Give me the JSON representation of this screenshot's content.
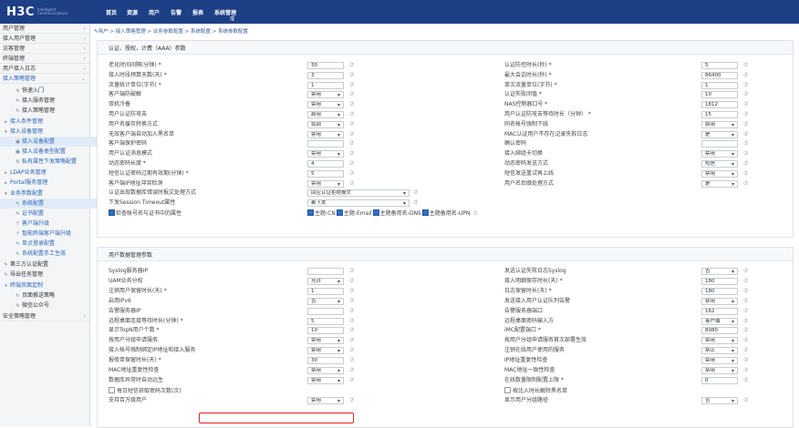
{
  "header": {
    "logo": "H3C",
    "logo_sub": "Intelligent Communications",
    "nav": [
      "首页",
      "资源",
      "用户",
      "告警",
      "报表",
      "系统管理"
    ],
    "nav_sub": "理"
  },
  "sidebar": {
    "items": [
      {
        "label": "用户管理"
      },
      {
        "label": "接入用户管理"
      },
      {
        "label": "访客管理"
      },
      {
        "label": "终端管理"
      },
      {
        "label": "用户接入日志"
      },
      {
        "label": "接入策略管理"
      },
      {
        "label": "快速入门"
      },
      {
        "label": "接入服务管理"
      },
      {
        "label": "接入策略管理"
      },
      {
        "label": "接入条件管理"
      },
      {
        "label": "接入设备管理"
      },
      {
        "label": "接入设备配置"
      },
      {
        "label": "接入设备类型配置"
      },
      {
        "label": "私有属性下发策略配置"
      },
      {
        "label": "LDAP业务管理"
      },
      {
        "label": "Portal服务管理"
      },
      {
        "label": "业务参数配置"
      },
      {
        "label": "系统配置"
      },
      {
        "label": "证书配置"
      },
      {
        "label": "客户端升级"
      },
      {
        "label": "智能终端客户端升级"
      },
      {
        "label": "单点登录配置"
      },
      {
        "label": "系统配置手工生效"
      },
      {
        "label": "第三方认证配置"
      },
      {
        "label": "导出任务管理"
      },
      {
        "label": "终端页面定制"
      },
      {
        "label": "页面推送策略"
      },
      {
        "label": "微信公众号"
      },
      {
        "label": "安全策略管理"
      }
    ]
  },
  "breadcrumb": "用户 > 接入策略管理 > 业务参数配置 > 系统配置 > 系统参数配置",
  "aaa": {
    "title": "认证、授权、计费（AAA）参数",
    "left": [
      {
        "label": "老化时间间隔(分钟) *",
        "value": "30",
        "type": "text"
      },
      {
        "label": "接入时段预算天数(天) *",
        "value": "3",
        "type": "text"
      },
      {
        "label": "流量统计单位(字节) *",
        "value": "1",
        "type": "text"
      },
      {
        "label": "客户端防破解",
        "value": "禁用",
        "type": "select"
      },
      {
        "label": "双机冷备",
        "value": "禁用",
        "type": "select"
      },
      {
        "label": "用户认证防攻击",
        "value": "启用",
        "type": "select"
      },
      {
        "label": "用户名缓存转换方式",
        "value": "如调",
        "type": "select"
      },
      {
        "label": "无效客户端自动加入黑名单",
        "value": "禁用",
        "type": "select"
      },
      {
        "label": "客户端保护密码",
        "value": "",
        "type": "text"
      },
      {
        "label": "用户认证消息模式",
        "value": "禁用",
        "type": "select"
      },
      {
        "label": "动态密码长度 *",
        "value": "4",
        "type": "text"
      },
      {
        "label": "短信认证密码过期有效期(分钟) *",
        "value": "5",
        "type": "text"
      },
      {
        "label": "客户端IP地址冲突检测",
        "value": "禁用",
        "type": "select"
      },
      {
        "label": "认证出现数据库错误时报文处理方式",
        "value": "回应认证拒绝报文",
        "type": "select"
      },
      {
        "label": "下发Session Timeout属性",
        "value": "都下发",
        "type": "select"
      },
      {
        "label": "检查帐号名与证书中的属性",
        "value": "",
        "type": "checks"
      }
    ],
    "right": [
      {
        "label": "认证防控时长(秒) *",
        "value": "5",
        "type": "text"
      },
      {
        "label": "最大会话时长(秒) *",
        "value": "86400",
        "type": "text"
      },
      {
        "label": "单次流量单位(字节) *",
        "value": "1",
        "type": "text"
      },
      {
        "label": "认证失败闭值 *",
        "value": "10",
        "type": "text"
      },
      {
        "label": "NAS控制器口号 *",
        "value": "1812",
        "type": "text"
      },
      {
        "label": "用户认证防攻击等待时长（分钟） *",
        "value": "15",
        "type": "text"
      },
      {
        "label": "同名帐号强制下线",
        "value": "启用",
        "type": "select"
      },
      {
        "label": "MAC认证用户不存在记录失败日志",
        "value": "是",
        "type": "select"
      },
      {
        "label": "确认密码",
        "value": "",
        "type": "text"
      },
      {
        "label": "接入绑组卡切换",
        "value": "禁用",
        "type": "select"
      },
      {
        "label": "动态密码发送方式",
        "value": "短信",
        "type": "select"
      },
      {
        "label": "短信发送重试再上线",
        "value": "禁用",
        "type": "select"
      },
      {
        "label": "用户名后缀处理方式",
        "value": "是",
        "type": "select"
      }
    ],
    "cert_checks": [
      "主题-CN",
      "主题-Email",
      "主题备用名-DNS",
      "主题备用名-UPN"
    ]
  },
  "user": {
    "title": "用户数据管理参数",
    "left": [
      {
        "label": "Syslog服务器IP",
        "value": "",
        "type": "text"
      },
      {
        "label": "UAM业务分权",
        "value": "允许",
        "type": "select"
      },
      {
        "label": "注销用户保留时长(天) *",
        "value": "1",
        "type": "text"
      },
      {
        "label": "启用IPv6",
        "value": "否",
        "type": "select"
      },
      {
        "label": "告警服务器IP",
        "value": "",
        "type": "text"
      },
      {
        "label": "远程桌面连接等待时长(分钟) *",
        "value": "5",
        "type": "text"
      },
      {
        "label": "显示TopN用户个数 *",
        "value": "10",
        "type": "text"
      },
      {
        "label": "按用户分组申请服务",
        "value": "禁用",
        "type": "select"
      },
      {
        "label": "接入帐号强制绑定IP地址和接入服务",
        "value": "禁用",
        "type": "select"
      },
      {
        "label": "报修单保留时长(天) *",
        "value": "30",
        "type": "text"
      },
      {
        "label": "MAC地址重复性检查",
        "value": "禁用",
        "type": "select"
      },
      {
        "label": "数据库异常时自动远生",
        "value": "禁用",
        "type": "select"
      },
      {
        "label": "每日短信获取密码次数(次)",
        "value": "",
        "type": "check"
      },
      {
        "label": "支持百万级用户",
        "value": "禁用",
        "type": "select"
      }
    ],
    "right": [
      {
        "label": "发送认证失败日志Syslog",
        "value": "否",
        "type": "select"
      },
      {
        "label": "接入明细保存时长(天) *",
        "value": "180",
        "type": "text"
      },
      {
        "label": "日志保留时长(天) *",
        "value": "180",
        "type": "text"
      },
      {
        "label": "发送接入用户认证队列告警",
        "value": "禁用",
        "type": "select"
      },
      {
        "label": "告警服务器端口",
        "value": "162",
        "type": "text"
      },
      {
        "label": "远程桌面密码输入方",
        "value": "客户端",
        "type": "select"
      },
      {
        "label": "iMC配置端口 *",
        "value": "8080",
        "type": "text"
      },
      {
        "label": "按用户分组申请服务首次部署生效",
        "value": "禁用",
        "type": "select"
      },
      {
        "label": "注销在线用户使用的服务",
        "value": "禁止",
        "type": "select"
      },
      {
        "label": "IP地址重复性检查",
        "value": "禁用",
        "type": "select"
      },
      {
        "label": "MAC地址一致性检查",
        "value": "禁用",
        "type": "select"
      },
      {
        "label": "在线数量限制配置上限 *",
        "value": "0",
        "type": "text"
      },
      {
        "label": "按比入时长解除黑名单",
        "value": "",
        "type": "check"
      },
      {
        "label": "显示用户分组路径",
        "value": "否",
        "type": "select"
      }
    ]
  }
}
